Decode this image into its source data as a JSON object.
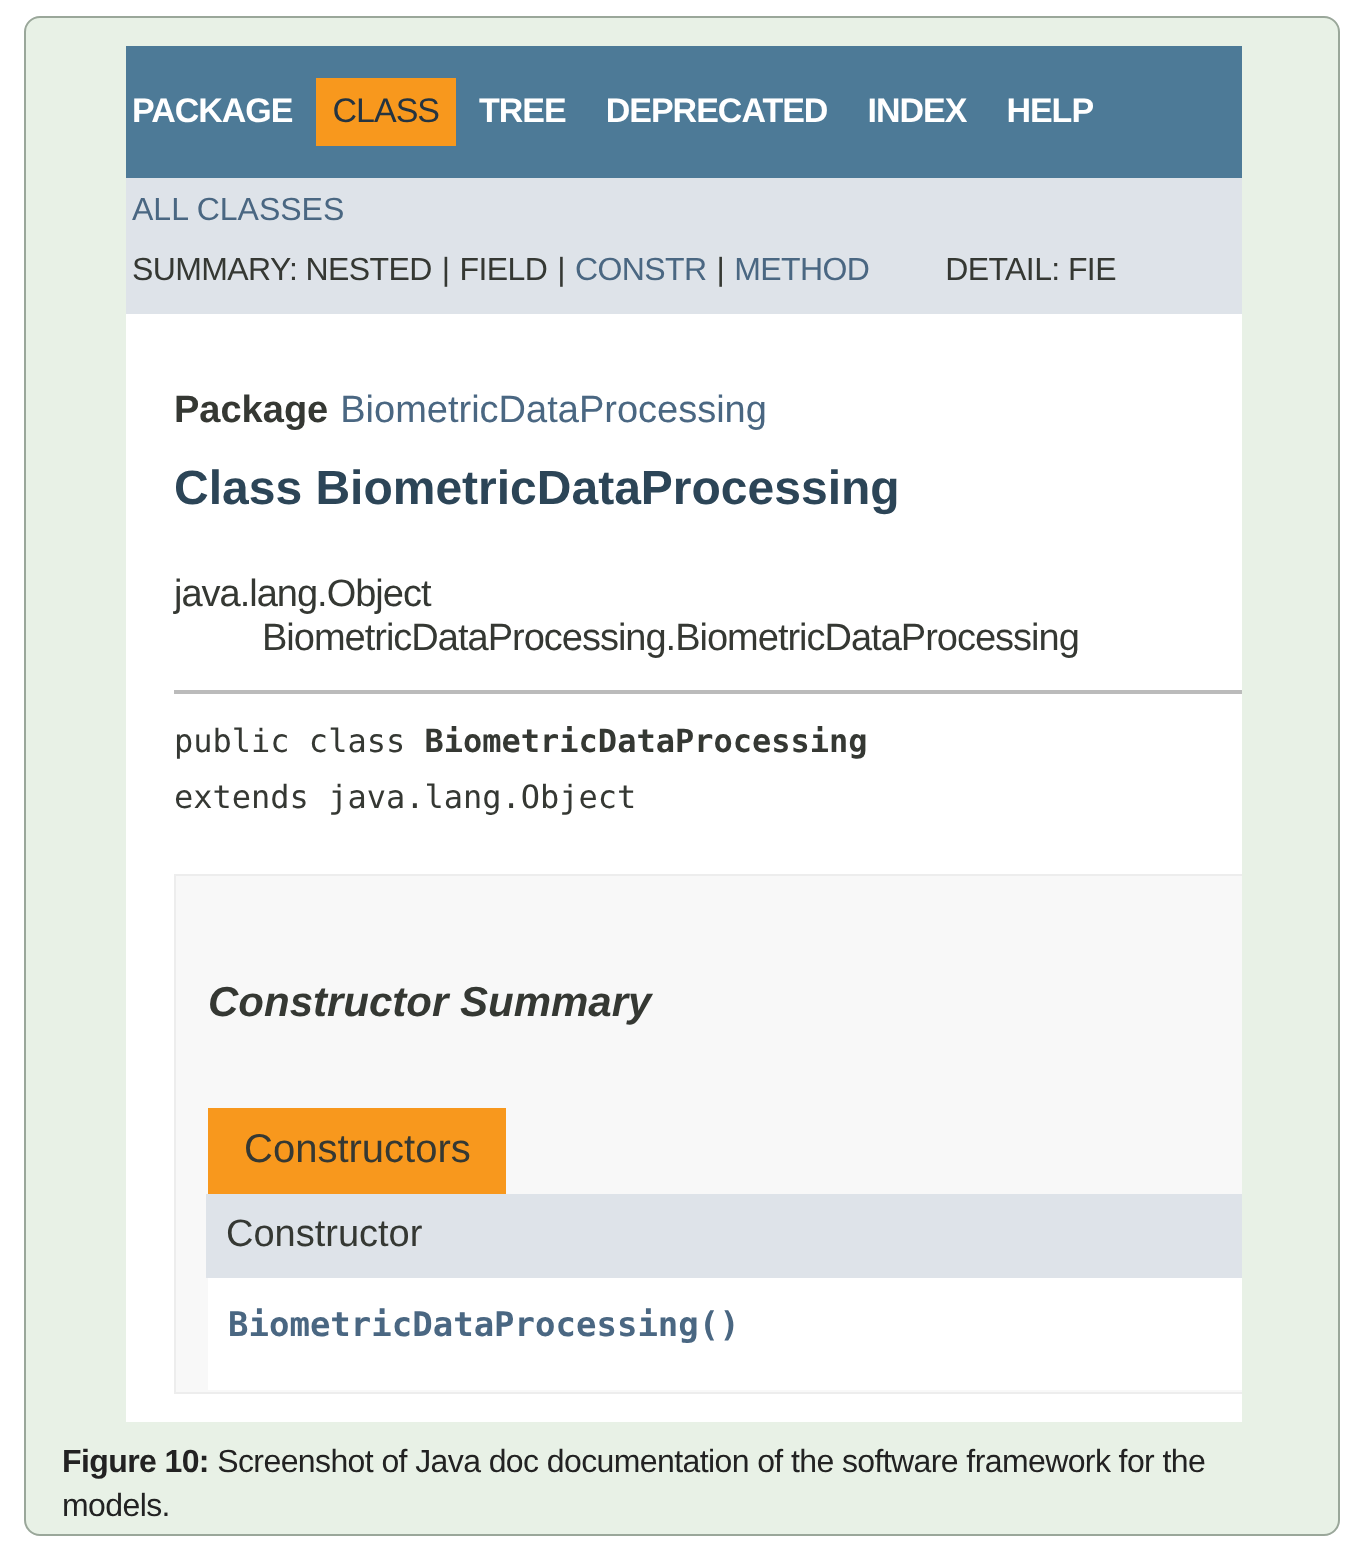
{
  "nav": [
    {
      "label": "PACKAGE",
      "selected": false
    },
    {
      "label": "CLASS",
      "selected": true
    },
    {
      "label": "TREE",
      "selected": false
    },
    {
      "label": "DEPRECATED",
      "selected": false
    },
    {
      "label": "INDEX",
      "selected": false
    },
    {
      "label": "HELP",
      "selected": false
    }
  ],
  "all_classes": "ALL CLASSES",
  "summary": [
    {
      "text": "SUMMARY: NESTED",
      "link": false
    },
    {
      "text": "|",
      "link": false
    },
    {
      "text": "FIELD",
      "link": false
    },
    {
      "text": "|",
      "link": false
    },
    {
      "text": "CONSTR",
      "link": true
    },
    {
      "text": "|",
      "link": false
    },
    {
      "text": "METHOD",
      "link": true
    }
  ],
  "detail": "DETAIL: FIE",
  "package": {
    "label": "Package",
    "name": "BiometricDataProcessing"
  },
  "class_title": "Class BiometricDataProcessing",
  "inheritance": [
    "java.lang.Object",
    "BiometricDataProcessing.BiometricDataProcessing"
  ],
  "declaration": [
    "public class **BiometricDataProcessing**",
    "extends java.lang.Object"
  ],
  "constructor_summary": {
    "title": "Constructor Summary",
    "tab": "Constructors",
    "column": "Constructor",
    "rows": [
      "BiometricDataProcessing()"
    ]
  },
  "caption": "**Figure 10:** Screenshot of Java doc documentation of the software framework for the models."
}
